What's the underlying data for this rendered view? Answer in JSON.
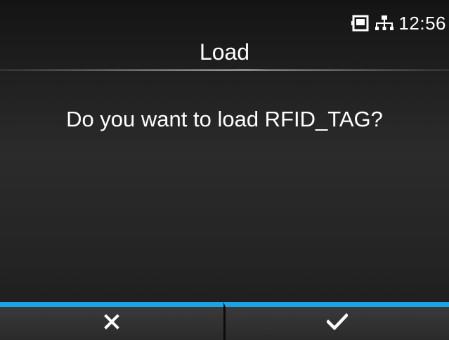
{
  "status": {
    "icons": [
      "memory-card-icon",
      "network-icon"
    ],
    "time": "12:56"
  },
  "dialog": {
    "title": "Load",
    "message": "Do you want to load RFID_TAG?"
  },
  "buttons": {
    "cancel_icon": "close-icon",
    "confirm_icon": "checkmark-icon"
  },
  "colors": {
    "accent": "#1ca3e6",
    "background": "#242424",
    "button": "#333333",
    "text": "#ffffff"
  }
}
